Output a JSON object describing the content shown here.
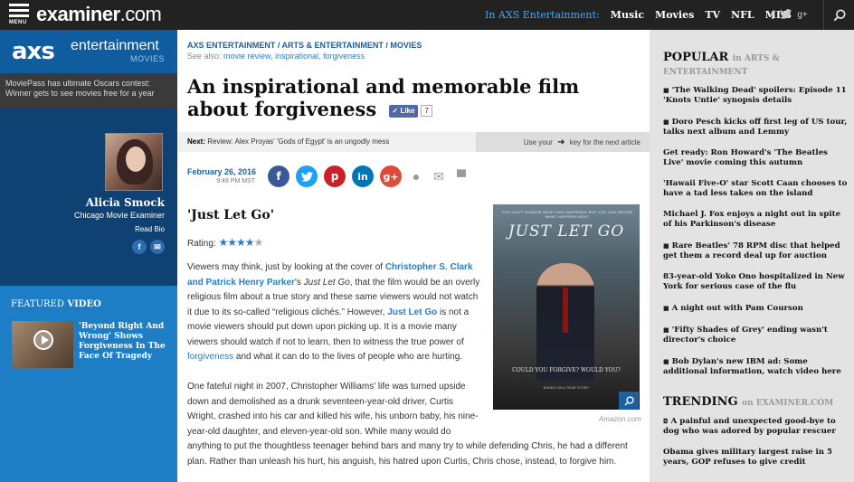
{
  "topbar": {
    "menu_label": "MENU",
    "logo_main": "examiner",
    "logo_tld": ".com",
    "in_label": "In AXS Entertainment:",
    "nav": [
      "Music",
      "Movies",
      "TV",
      "NFL",
      "MLB"
    ],
    "social_icons": [
      "facebook-icon",
      "twitter-icon",
      "google-plus-icon"
    ],
    "social_glyphs": {
      "facebook": "f",
      "twitter": "t",
      "gplus": "g+"
    },
    "search_icon": "search-icon"
  },
  "left": {
    "axs": "axs",
    "entertainment": "entertainment",
    "movies": "MOVIES",
    "promo": "MoviePass has ultimate Oscars contest: Winner gets to see movies free for a year",
    "author_name": "Alicia Smock",
    "author_role": "Chicago Movie Examiner",
    "read_bio": "Read Bio",
    "author_social_glyphs": [
      "f",
      "✉"
    ],
    "featured_label_1": "FEATURED",
    "featured_label_2": "VIDEO",
    "featured_caption": "'Beyond Right And Wrong' Shows Forgiveness In The Face Of Tragedy"
  },
  "article": {
    "breadcrumb": "AXS ENTERTAINMENT / ARTS & ENTERTAINMENT / MOVIES",
    "see_also_label": "See also:",
    "see_also_links": "movie review, inspirational, forgiveness",
    "headline": "An inspirational and memorable film about forgiveness",
    "like_label": "Like",
    "like_count": "7",
    "next_label": "Next:",
    "next_text": "Review: Alex Proyas' 'Gods of Egypt' is an ungodly mess",
    "use_key_1": "Use your",
    "use_key_2": "key for the next article",
    "date": "February 26, 2016",
    "time": "9:49 PM MST",
    "share_glyphs": {
      "fb": "f",
      "tw": "t",
      "pi": "p",
      "li": "in",
      "gp": "g+",
      "comment": "●",
      "email": "✉",
      "print": "▀"
    },
    "subhead": "'Just Let Go'",
    "rating_label": "Rating:",
    "rating": 4,
    "rating_max": 5,
    "p1_a": "Viewers may think, just by looking at the cover of ",
    "p1_link": "Christopher S. Clark and Patrick Henry Parker",
    "p1_b": "'s ",
    "p1_title": "Just Let Go",
    "p1_c": ", that the film would be an overly religious film about a true story and these same viewers would not watch it due to its so-called “religious clichés.” However, ",
    "p1_link2": "Just Let Go",
    "p1_d": " is not a movie viewers should put down upon picking up. It is a movie many viewers should watch if not to learn, then to witness the true power of ",
    "p1_link3": "forgiveness",
    "p1_e": " and what it can do to the lives of people who are hurting.",
    "p2_short": "One fateful night in 2007, Christopher Williams' life was turned upside down and demolished as a drunk seventeen-year-old driver, Curtis Wright, crashed into his car and killed his wife, his unborn baby, his nine-year-old daughter, and eleven-year-old son. While many would do",
    "p2_long": "anything to put the thoughtless teenager behind bars and many try to while defending Chris, he had a different plan. Rather than unleash his hurt, his anguish, his hatred upon Curtis, Chris chose, instead, to forgive him.",
    "poster_top": "YOU CAN'T CHANGE WHAT HAS HAPPENED BUT YOU CAN DECIDE WHAT HAPPENS NEXT",
    "poster_title": "JUST LET GO",
    "poster_tagline": "COULD YOU FORGIVE? WOULD YOU?",
    "poster_sub": "BASED ON A TRUE STORY",
    "poster_credit": "Amazon.com"
  },
  "right": {
    "popular_title": "POPULAR",
    "popular_sub": "in ARTS & ENTERTAINMENT",
    "popular": [
      {
        "text": "'The Walking Dead' spoilers: Episode 11 'Knots Untie' synopsis details",
        "video": true
      },
      {
        "text": "Doro Pesch kicks off first leg of US tour, talks next album and Lemmy",
        "video": true
      },
      {
        "text": "Get ready: Ron Howard's 'The Beatles Live' movie coming this autumn",
        "video": false
      },
      {
        "text": "'Hawaii Five-O' star Scott Caan chooses to have a tad less takes on the island",
        "video": false
      },
      {
        "text": "Michael J. Fox enjoys a night out in spite of his Parkinson's disease",
        "video": false
      },
      {
        "text": "Rare Beatles' 78 RPM disc that helped get them a record deal up for auction",
        "video": true
      },
      {
        "text": "83-year-old Yoko Ono hospitalized in New York for serious case of the flu",
        "video": false
      },
      {
        "text": "A night out with Pam Courson",
        "video": true
      },
      {
        "text": "'Fifty Shades of Grey' ending wasn't director's choice",
        "video": true
      },
      {
        "text": "Bob Dylan's new IBM ad: Some additional information, watch video here",
        "video": true
      }
    ],
    "trending_title": "TRENDING",
    "trending_sub": "on EXAMINER.COM",
    "trending": [
      {
        "text": "A painful and unexpected good-bye to dog who was adored by popular rescuer",
        "camera": true
      },
      {
        "text": "Obama gives military largest raise in 5 years, GOP refuses to give credit",
        "camera": false
      }
    ]
  },
  "colors": {
    "topbar": "#222222",
    "axs_blue": "#0f5d9e",
    "sidebar_navy": "#0f4272",
    "featured_blue": "#1d7ec6",
    "link": "#2a7fc1",
    "right_bg": "#e3e3e3"
  }
}
